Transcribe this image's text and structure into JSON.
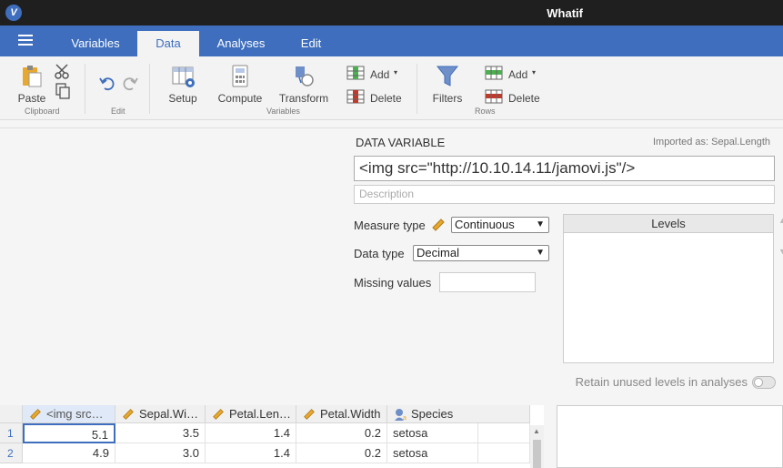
{
  "app": {
    "title": "Whatif",
    "logo": "V"
  },
  "menu": {
    "tabs": [
      {
        "label": "Variables"
      },
      {
        "label": "Data"
      },
      {
        "label": "Analyses"
      },
      {
        "label": "Edit"
      }
    ],
    "active_tab": "Data"
  },
  "ribbon": {
    "clipboard": {
      "paste": "Paste",
      "group": "Clipboard"
    },
    "edit": {
      "group": "Edit"
    },
    "variables": {
      "setup": "Setup",
      "compute": "Compute",
      "transform": "Transform",
      "add": "Add",
      "delete": "Delete",
      "group": "Variables"
    },
    "rows": {
      "filters": "Filters",
      "add": "Add",
      "delete": "Delete",
      "group": "Rows"
    }
  },
  "variable_editor": {
    "heading": "DATA VARIABLE",
    "imported_as": "Imported as:  Sepal.Length",
    "name_value": "<img src=\"http://10.10.14.11/jamovi.js\"/>",
    "description_placeholder": "Description",
    "measure_type_label": "Measure type",
    "measure_type_value": "Continuous",
    "data_type_label": "Data type",
    "data_type_value": "Decimal",
    "missing_values_label": "Missing values",
    "levels_header": "Levels",
    "retain_label": "Retain unused levels in analyses"
  },
  "grid": {
    "columns": [
      {
        "label": "<img src…",
        "icon": "ruler-icon"
      },
      {
        "label": "Sepal.Wi…",
        "icon": "ruler-icon"
      },
      {
        "label": "Petal.Len…",
        "icon": "ruler-icon"
      },
      {
        "label": "Petal.Width",
        "icon": "ruler-icon"
      },
      {
        "label": "Species",
        "icon": "nominal-icon"
      }
    ],
    "rows": [
      {
        "n": "1",
        "cells": [
          "5.1",
          "3.5",
          "1.4",
          "0.2",
          "setosa"
        ]
      },
      {
        "n": "2",
        "cells": [
          "4.9",
          "3.0",
          "1.4",
          "0.2",
          "setosa"
        ]
      }
    ]
  },
  "colors": {
    "accent": "#3e6ebd",
    "titlebar": "#1f1f1f",
    "ruler": "#e8a830"
  }
}
